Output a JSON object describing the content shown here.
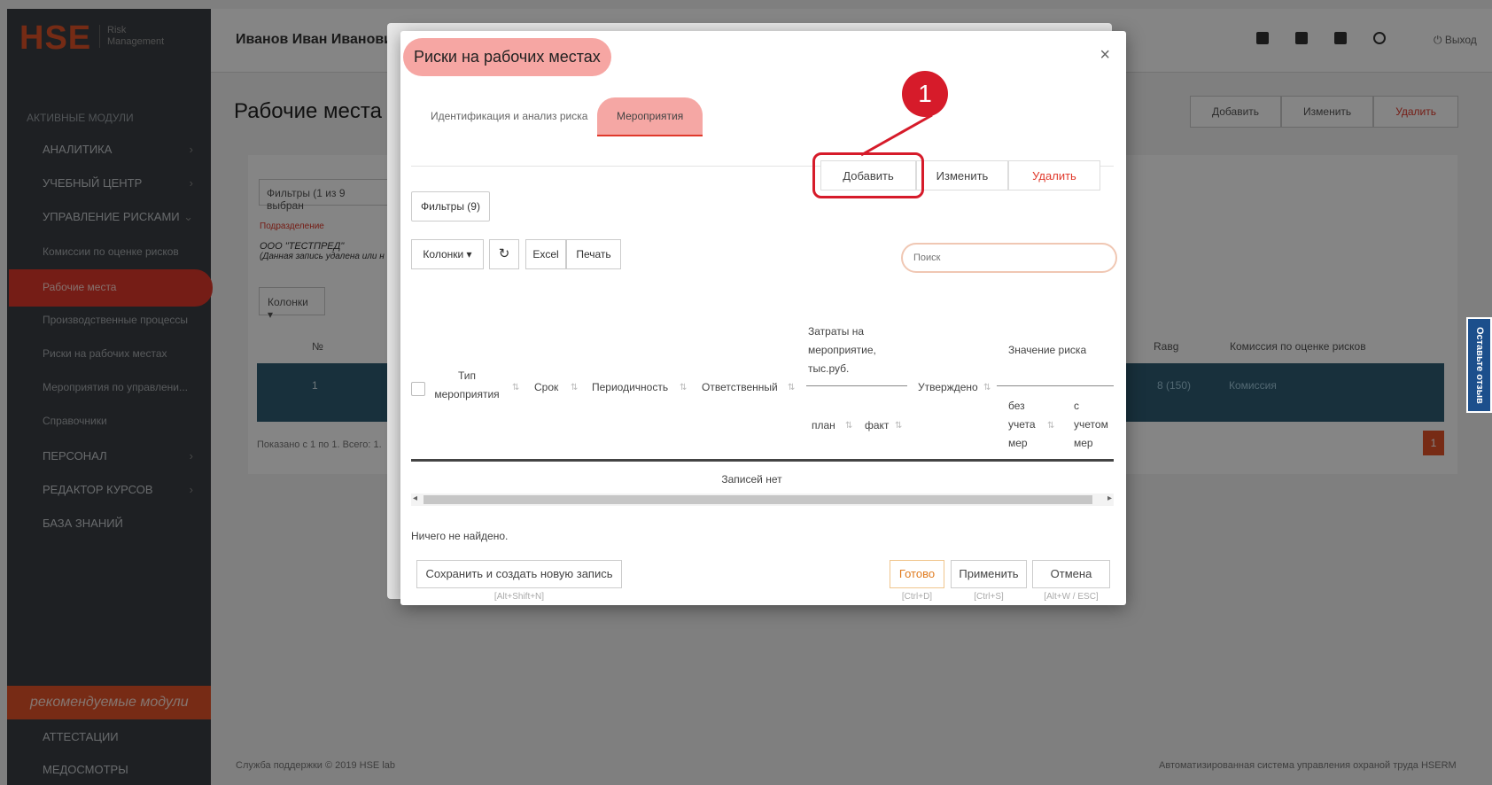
{
  "app": {
    "logo": "HSE",
    "logo_sub_1": "Risk",
    "logo_sub_2": "Management",
    "user_name": "Иванов Иван Иванови",
    "logout": "⏻ Выход",
    "footer_left": "Служба поддержки © 2019 HSE lab",
    "footer_right": "Автоматизированная система управления охраной труда HSERM",
    "feedback": "Оставьте отзыв"
  },
  "sidebar": {
    "section_title": "АКТИВНЫЕ МОДУЛИ",
    "items": [
      {
        "label": "АНАЛИТИКА",
        "chev": "›"
      },
      {
        "label": "УЧЕБНЫЙ ЦЕНТР",
        "chev": "›"
      },
      {
        "label": "УПРАВЛЕНИЕ РИСКАМИ",
        "chev": "⌄"
      },
      {
        "label": "ПЕРСОНАЛ",
        "chev": "›"
      },
      {
        "label": "РЕДАКТОР КУРСОВ",
        "chev": "›"
      },
      {
        "label": "БАЗА ЗНАНИЙ",
        "chev": ""
      }
    ],
    "sub_items": [
      "Комиссии по оценке рисков",
      "Рабочие места",
      "Производственные процессы",
      "Риски на рабочих местах",
      "Мероприятия по управлени...",
      "Справочники"
    ],
    "recommended": "рекомендуемые модули",
    "extra": [
      "АТТЕСТАЦИИ",
      "МЕДОСМОТРЫ"
    ]
  },
  "background_page": {
    "title": "Рабочие места",
    "actions": {
      "add": "Добавить",
      "edit": "Изменить",
      "delete": "Удалить"
    },
    "filter": "Фильтры (1 из 9 выбран",
    "sub_label": "Подразделение",
    "sub_value": "ООО \"ТЕСТПРЕД\"",
    "sub_note": "(Данная запись удалена или н",
    "columns": "Колонки ▾",
    "head_num": "№",
    "head_r": "Rавg",
    "head_comm": "Комиссия по оценке рисков",
    "row_num": "1",
    "row_r": "8 (150)",
    "row_comm": "Комиссия",
    "shown": "Показано с 1 по 1. Всего: 1.",
    "page": "1"
  },
  "dialog": {
    "title": "Риски на рабочих местах",
    "close": "×",
    "tabs": [
      "Идентификация и анализ риска",
      "Мероприятия"
    ],
    "annotation": "1",
    "actions": {
      "add": "Добавить",
      "edit": "Изменить",
      "delete": "Удалить"
    },
    "filters": "Фильтры (9)",
    "toolbar": {
      "columns": "Колонки ▾",
      "refresh": "↻",
      "excel": "Excel",
      "print": "Печать"
    },
    "search_placeholder": "Поиск",
    "table": {
      "type": "Тип\nмероприятия",
      "term": "Срок",
      "period": "Периодичность",
      "responsible": "Ответственный",
      "cost_group": "Затраты на\nмероприятие,\nтыс.руб.",
      "plan": "план",
      "fact": "факт",
      "approved": "Утверждено",
      "risk_group": "Значение риска",
      "risk_without": "без\nучета\nмер",
      "risk_with": "с\nучетом\nмер",
      "sort": "⇅",
      "no_records": "Записей нет"
    },
    "nothing_found": "Ничего не найдено.",
    "footer": {
      "save_new": "Сохранить и создать новую запись",
      "save_new_hint": "[Alt+Shift+N]",
      "done": "Готово",
      "done_hint": "[Ctrl+D]",
      "apply": "Применить",
      "apply_hint": "[Ctrl+S]",
      "cancel": "Отмена",
      "cancel_hint": "[Alt+W / ESC]"
    }
  }
}
